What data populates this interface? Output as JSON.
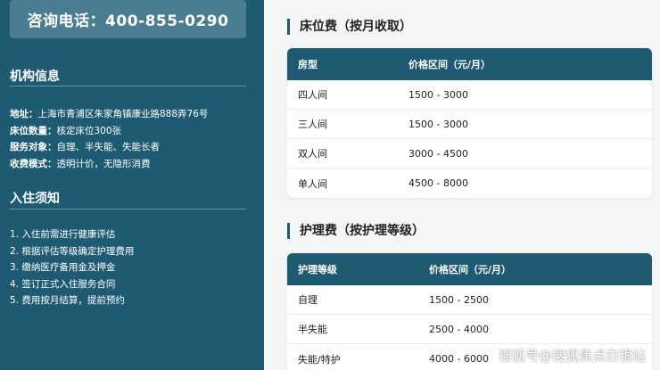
{
  "sidebar": {
    "phone": "咨询电话：400-855-0290",
    "org_title": "机构信息",
    "info": [
      {
        "key": "地址：",
        "value": "上海市青浦区朱家角镇康业路888弄76号"
      },
      {
        "key": "床位数量：",
        "value": "核定床位300张"
      },
      {
        "key": "服务对象：",
        "value": "自理、半失能、失能长者"
      },
      {
        "key": "收费模式：",
        "value": "透明计价，无隐形消费"
      }
    ],
    "notice_title": "入住须知",
    "notice": [
      "1. 入住前需进行健康评估",
      "2. 根据评估等级确定护理费用",
      "3. 缴纳医疗备用金及押金",
      "4. 签订正式入住服务合同",
      "5. 费用按月结算，提前预约"
    ]
  },
  "bed_fee": {
    "title": "床位费（按月收取）",
    "headers": [
      "房型",
      "价格区间（元/月）"
    ],
    "rows": [
      [
        "四人间",
        "1500 - 3000"
      ],
      [
        "三人间",
        "1500 - 3000"
      ],
      [
        "双人间",
        "3000 - 4500"
      ],
      [
        "单人间",
        "4500 - 8000"
      ]
    ]
  },
  "care_fee": {
    "title": "护理费（按护理等级）",
    "headers": [
      "护理等级",
      "价格区间（元/月）"
    ],
    "rows": [
      [
        "自理",
        "1500 - 2500"
      ],
      [
        "半失能",
        "2500 - 4000"
      ],
      [
        "失能/特护",
        "4000 - 6000"
      ]
    ]
  },
  "watermark": "搜狐号@搜狐焦点白银站"
}
